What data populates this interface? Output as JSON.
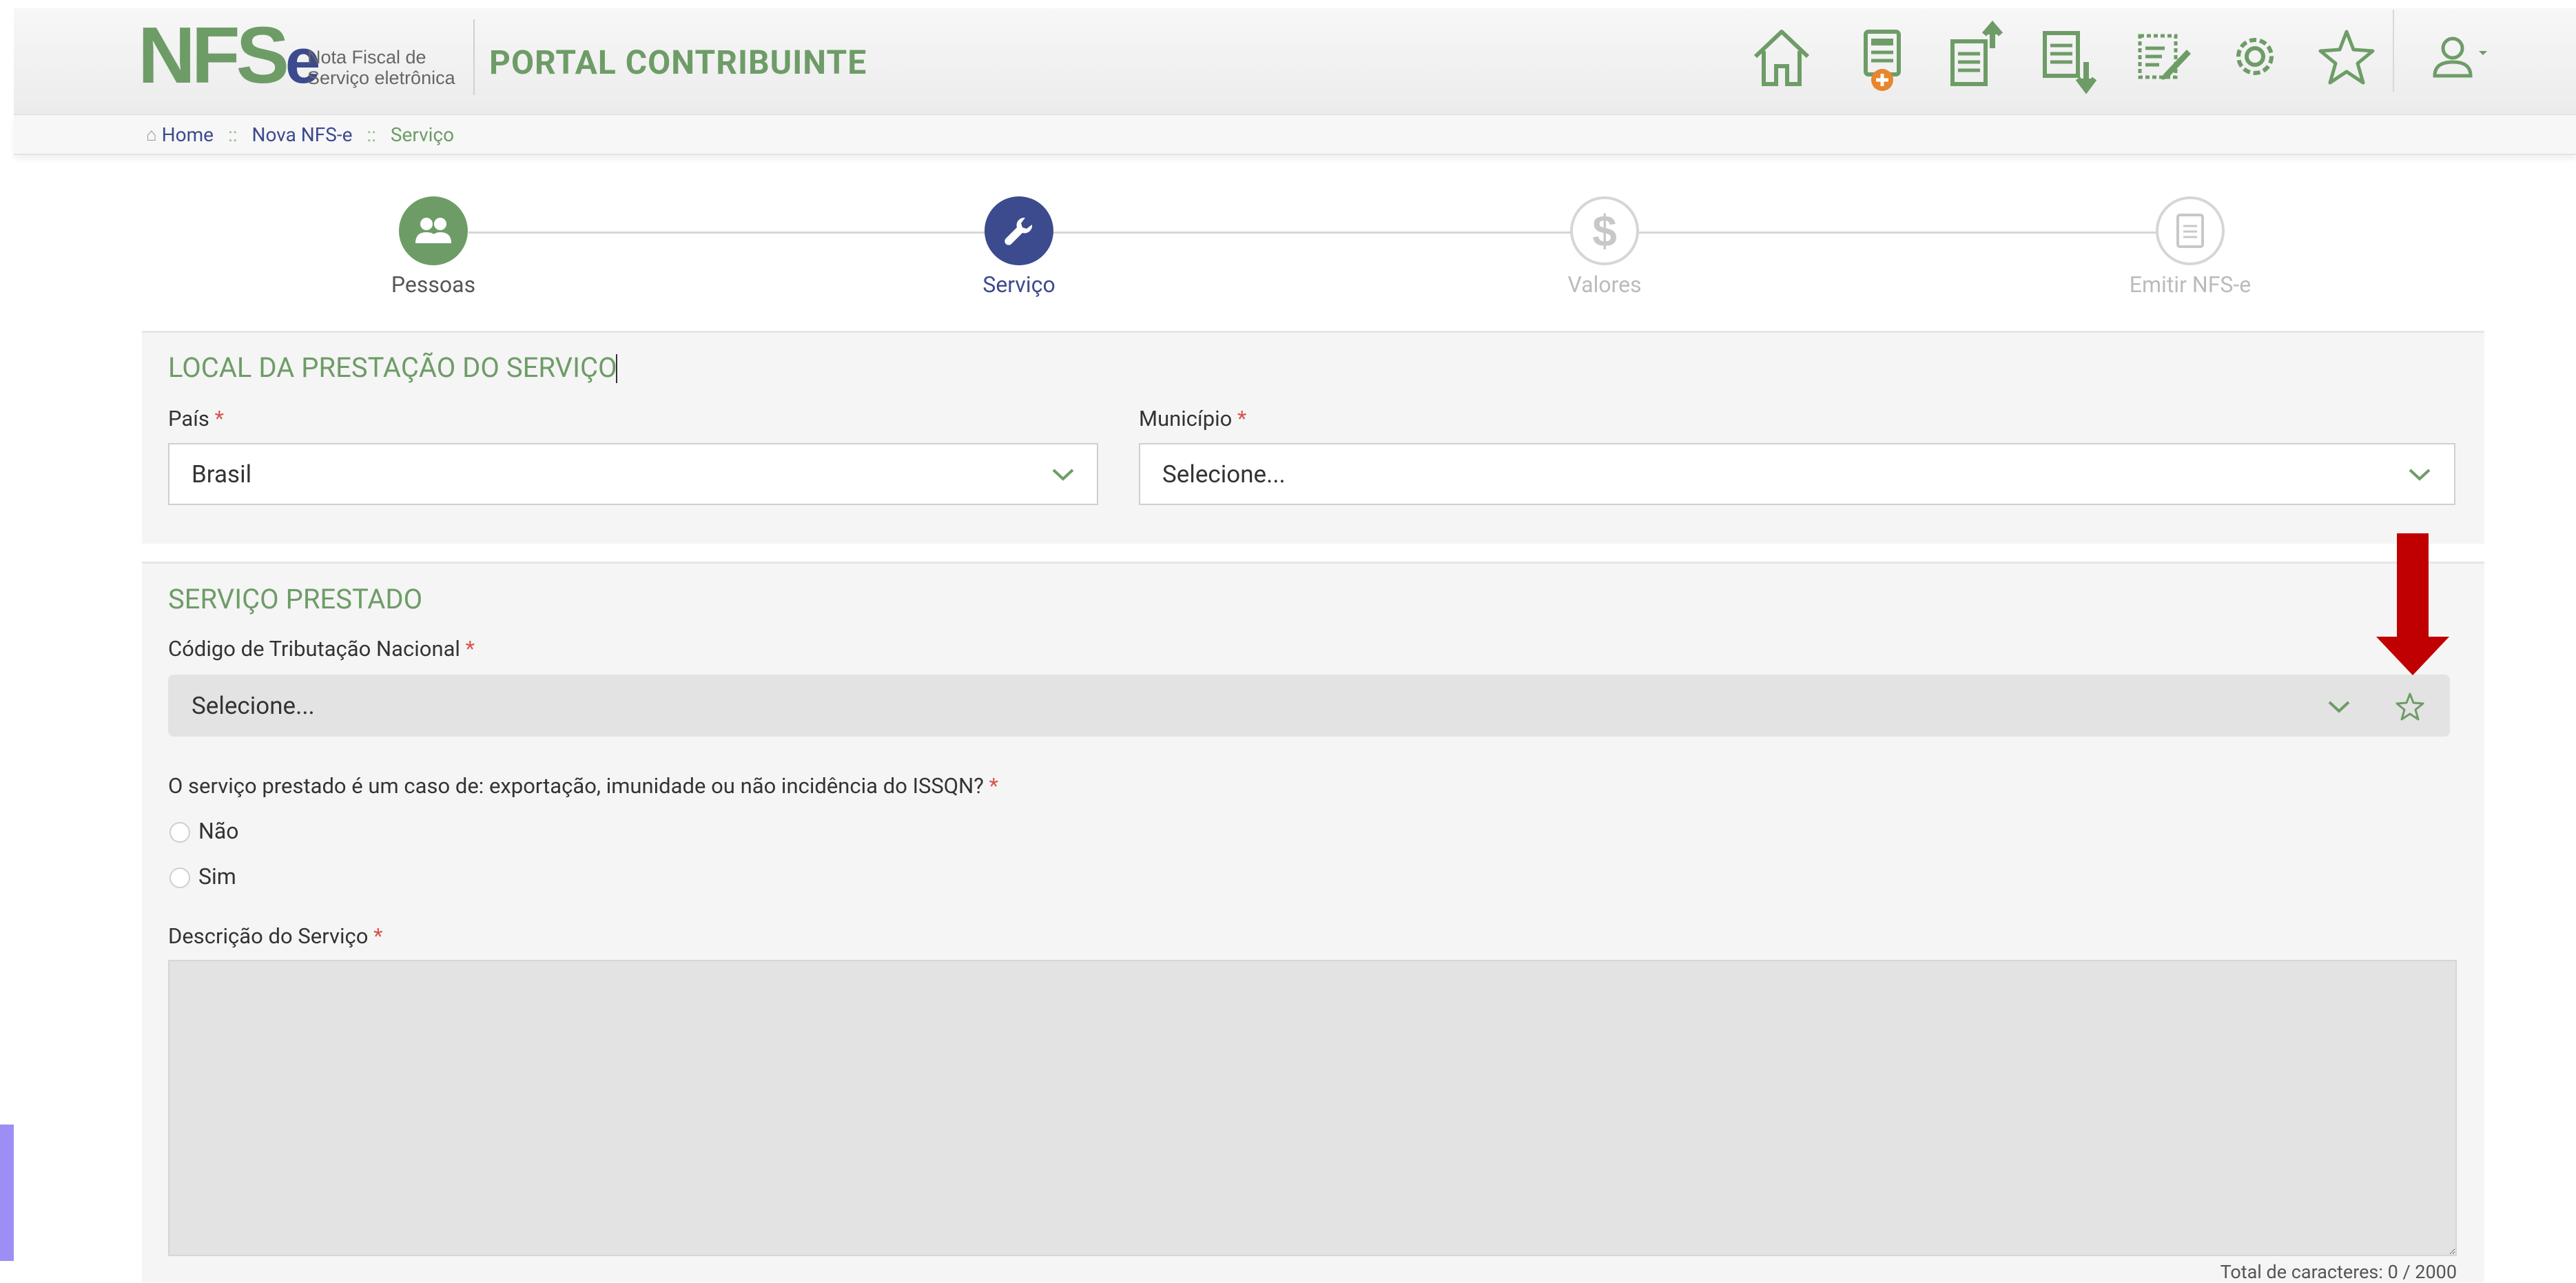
{
  "header": {
    "logo_main": "NFS",
    "logo_e": "e",
    "logo_sub_line1": "Nota Fiscal de",
    "logo_sub_line2": "Serviço eletrônica",
    "portal_title": "PORTAL CONTRIBUINTE",
    "icons": [
      "home-icon",
      "new-nfse-icon",
      "issued-notes-icon",
      "received-notes-icon",
      "edit-notes-icon",
      "settings-icon",
      "favorites-icon",
      "user-icon"
    ]
  },
  "breadcrumb": {
    "items": [
      "Home",
      "Nova NFS-e",
      "Serviço"
    ],
    "separator": "::"
  },
  "steps": [
    {
      "label": "Pessoas",
      "state": "done"
    },
    {
      "label": "Serviço",
      "state": "current"
    },
    {
      "label": "Valores",
      "state": "pending"
    },
    {
      "label": "Emitir NFS-e",
      "state": "pending"
    }
  ],
  "local": {
    "title": "LOCAL DA PRESTAÇÃO DO SERVIÇO",
    "pais_label": "País",
    "pais_value": "Brasil",
    "municipio_label": "Município",
    "municipio_value": "Selecione..."
  },
  "servico": {
    "title": "SERVIÇO PRESTADO",
    "codigo_label": "Código de Tributação Nacional",
    "codigo_value": "Selecione...",
    "question": "O serviço prestado é um caso de: exportação, imunidade ou não incidência do ISSQN?",
    "options": [
      "Não",
      "Sim"
    ],
    "descricao_label": "Descrição do Serviço",
    "descricao_value": "",
    "char_count": "Total de caracteres: 0 / 2000"
  },
  "required_mark": "*",
  "colors": {
    "green": "#6e9c67",
    "navy": "#3c4a8e",
    "annotation_arrow": "#c00000"
  }
}
